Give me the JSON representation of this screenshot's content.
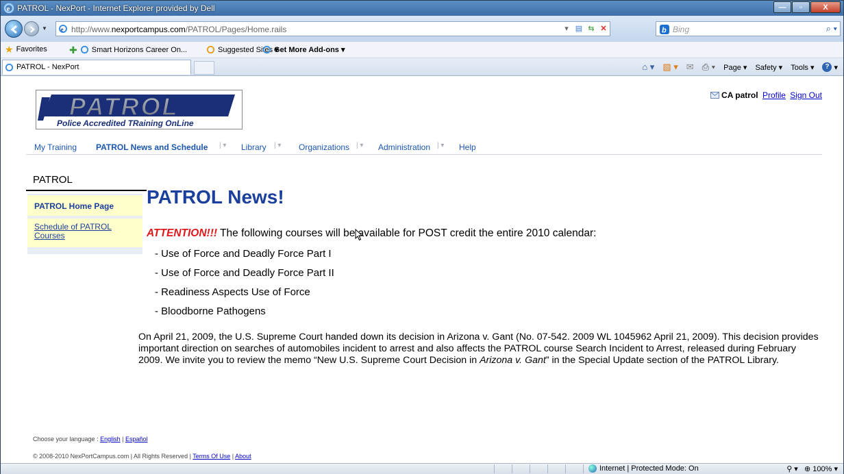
{
  "browser": {
    "window_title": "PATROL - NexPort - Internet Explorer provided by Dell",
    "url_prefix": "http://www.",
    "url_domain": "nexportcampus.com",
    "url_path": "/PATROL/Pages/Home.rails",
    "search_placeholder": "Bing",
    "favorites_label": "Favorites",
    "fav_links": [
      "Smart Horizons Career On...",
      "Suggested Sites ▾",
      "Get More Add-ons ▾"
    ],
    "tab_title": "PATROL - NexPort",
    "commands": [
      "Page ▾",
      "Safety ▾",
      "Tools ▾"
    ],
    "status_zone": "Internet | Protected Mode: On",
    "zoom": "100%"
  },
  "site": {
    "logo_text": "PATROL",
    "logo_tagline": "Police Accredited TRaining OnLine",
    "user_name": "CA patrol",
    "profile_link": "Profile",
    "signout_link": "Sign Out",
    "nav": [
      "My Training",
      "PATROL News and Schedule",
      "Library",
      "Organizations",
      "Administration",
      "Help"
    ]
  },
  "sidebar": {
    "title": "PATROL",
    "items": [
      "PATROL Home Page",
      "Schedule of PATROL Courses"
    ]
  },
  "content": {
    "heading": "PATROL News!",
    "attention": "ATTENTION!!!",
    "attention_text": " The following courses will be available for POST credit the entire 2010 calendar:",
    "courses": [
      "- Use of Force and Deadly Force Part I",
      "- Use of Force and Deadly Force Part II",
      "- Readiness Aspects Use of Force",
      "- Bloodborne Pathogens"
    ],
    "paragraph_a": "On April 21, 2009, the U.S. Supreme Court handed down its decision in Arizona v. Gant (No. 07-542. 2009 WL 1045962 April 21, 2009). This decision provides important direction on searches of automobiles incident to arrest and also affects the PATROL course Search Incident to Arrest, released during February 2009.  We invite you to review the memo “New U.S. Supreme Court Decision in ",
    "paragraph_em": "Arizona v. Gant",
    "paragraph_b": "” in the Special Update section of the PATROL Library."
  },
  "footer": {
    "language_label": "Choose your language : ",
    "lang_en": "English",
    "lang_es": "Español",
    "copyright": "© 2008-2010 NexPortCampus.com | All Rights Reserved | ",
    "terms": "Terms Of Use",
    "about": "About"
  },
  "colors": {
    "link_blue": "#1a56b0",
    "heading_blue": "#1a3f9c",
    "attention_red": "#e0181b",
    "sidebar_yellow": "#ffffcc"
  }
}
